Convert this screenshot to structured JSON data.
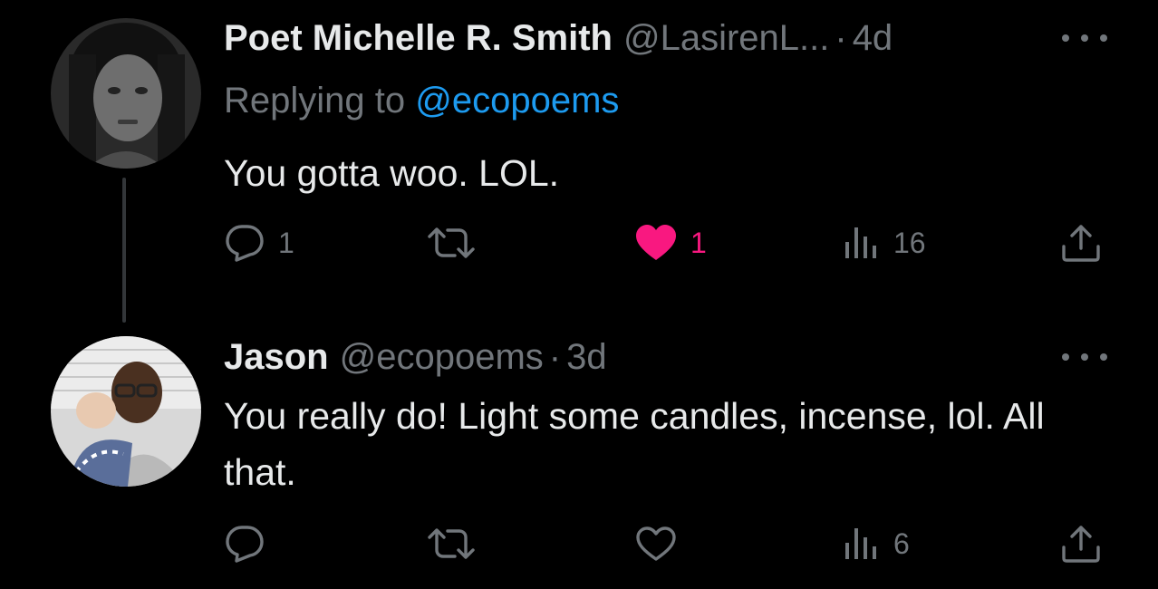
{
  "tweets": [
    {
      "name": "Poet Michelle R. Smith",
      "handle": "@LasirenL...",
      "dot": "·",
      "time": "4d",
      "replying_prefix": "Replying to",
      "replying_handle": "@ecopoems",
      "text": "You gotta woo. LOL.",
      "reply_count": "1",
      "retweet_count": "",
      "like_count": "1",
      "liked": true,
      "view_count": "16"
    },
    {
      "name": "Jason",
      "handle": "@ecopoems",
      "dot": "·",
      "time": "3d",
      "text": "You really do! Light some candles, incense, lol. All that.",
      "reply_count": "",
      "retweet_count": "",
      "like_count": "",
      "liked": false,
      "view_count": "6"
    }
  ],
  "icons": {
    "reply": "reply-icon",
    "retweet": "retweet-icon",
    "like": "heart-icon",
    "views": "views-icon",
    "share": "share-icon",
    "more": "more-icon"
  },
  "colors": {
    "background": "#000000",
    "text": "#e7e9ea",
    "muted": "#71767b",
    "link": "#1d9bf0",
    "like": "#f91880"
  }
}
